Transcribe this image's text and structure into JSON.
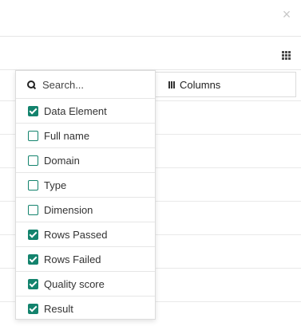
{
  "panel": {
    "close_glyph": "×"
  },
  "columns_menu": {
    "button_label": "Columns",
    "search": {
      "placeholder": "Search...",
      "value": ""
    },
    "options": [
      {
        "label": "Data Element",
        "checked": true
      },
      {
        "label": "Full name",
        "checked": false
      },
      {
        "label": "Domain",
        "checked": false
      },
      {
        "label": "Type",
        "checked": false
      },
      {
        "label": "Dimension",
        "checked": false
      },
      {
        "label": "Rows Passed",
        "checked": true
      },
      {
        "label": "Rows Failed",
        "checked": true
      },
      {
        "label": "Quality score",
        "checked": true
      },
      {
        "label": "Result",
        "checked": true
      }
    ]
  },
  "colors": {
    "checkbox_accent": "#13836d",
    "border": "#dcdcdc"
  }
}
